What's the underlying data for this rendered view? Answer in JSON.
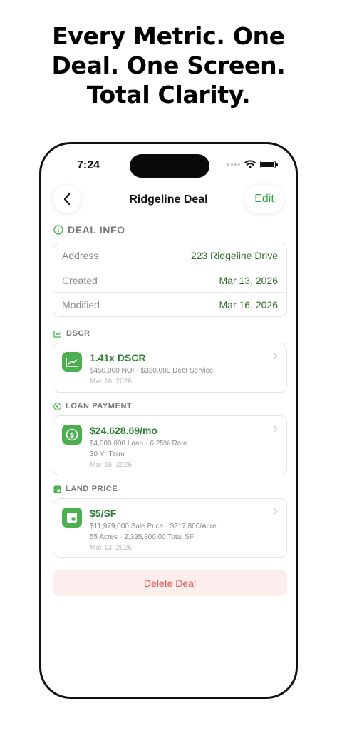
{
  "headline": {
    "line1": "Every Metric. One",
    "line2": "Deal. One Screen.",
    "line3": "Total Clarity."
  },
  "status_bar": {
    "time": "7:24",
    "icons": [
      "signal-dots-icon",
      "wifi-icon",
      "battery-icon"
    ]
  },
  "nav": {
    "title": "Ridgeline Deal",
    "edit_label": "Edit",
    "back_icon": "chevron-left-icon"
  },
  "deal_info": {
    "header": "DEAL INFO",
    "icon": "info-circle-icon",
    "rows": [
      {
        "label": "Address",
        "value": "223 Ridgeline Drive"
      },
      {
        "label": "Created",
        "value": "Mar 13, 2026"
      },
      {
        "label": "Modified",
        "value": "Mar 16, 2026"
      }
    ]
  },
  "dscr": {
    "header": "DSCR",
    "icon": "trend-chart-icon",
    "title": "1.41x DSCR",
    "sub1a": "$450,000 NOI",
    "sub1b": "$320,000 Debt Service",
    "date": "Mar 16, 2026"
  },
  "loan": {
    "header": "LOAN PAYMENT",
    "icon": "dollar-circle-icon",
    "title": "$24,628.69/mo",
    "sub1a": "$4,000,000 Loan",
    "sub1b": "6.25% Rate",
    "sub2": "30 Yr Term",
    "date": "Mar 16, 2026"
  },
  "land": {
    "header": "LAND PRICE",
    "icon": "land-square-icon",
    "title": "$5/SF",
    "sub1a": "$11,979,000 Sale Price",
    "sub1b": "$217,800/Acre",
    "sub2a": "55 Acres",
    "sub2b": "2,395,800.00 Total SF",
    "date": "Mar 13, 2026"
  },
  "delete_label": "Delete Deal",
  "colors": {
    "accent_green": "#4caf50",
    "value_green": "#2f6b2a",
    "delete_red": "#e25454",
    "delete_bg": "#fdeeee"
  }
}
